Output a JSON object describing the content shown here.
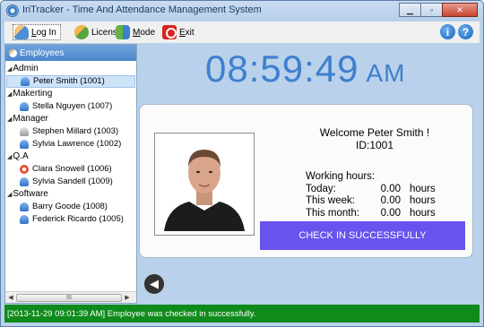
{
  "window": {
    "title": "IriTracker - Time And Attendance Management System",
    "minimize_glyph": "▁",
    "maximize_glyph": "▫",
    "close_glyph": "✕"
  },
  "toolbar": {
    "login_prefix": "L",
    "login_rest": "og In",
    "license_label": "License",
    "mode_prefix": "M",
    "mode_rest": "ode",
    "exit_prefix": "E",
    "exit_rest": "xit",
    "info_glyph": "i",
    "help_glyph": "?"
  },
  "employees_panel": {
    "header": "Employees",
    "groups": [
      {
        "name": "Admin",
        "members": [
          {
            "name": "Peter Smith (1001)",
            "status": "online",
            "selected": true
          }
        ]
      },
      {
        "name": "Makerting",
        "members": [
          {
            "name": "Stella Nguyen (1007)",
            "status": "online"
          }
        ]
      },
      {
        "name": "Manager",
        "members": [
          {
            "name": "Stephen Millard (1003)",
            "status": "offline"
          },
          {
            "name": "Sylvia Lawrence (1002)",
            "status": "online"
          }
        ]
      },
      {
        "name": "Q.A",
        "members": [
          {
            "name": "Clara Snowell (1006)",
            "status": "away"
          },
          {
            "name": "Sylvia Sandell (1009)",
            "status": "online"
          }
        ]
      },
      {
        "name": "Software",
        "members": [
          {
            "name": "Barry Goode (1008)",
            "status": "online"
          },
          {
            "name": "Federick Ricardo (1005)",
            "status": "online"
          }
        ]
      }
    ],
    "scroll_grip": "III"
  },
  "clock": {
    "time": "08:59:49",
    "ampm": "AM"
  },
  "card": {
    "welcome_line": "Welcome Peter Smith !",
    "id_line": "ID:1001",
    "working_hours_label": "Working hours:",
    "rows": [
      {
        "label": "Today:",
        "value": "0.00",
        "unit": "hours"
      },
      {
        "label": "This week:",
        "value": "0.00",
        "unit": "hours"
      },
      {
        "label": "This month:",
        "value": "0.00",
        "unit": "hours"
      }
    ],
    "checkin_label": "CHECK IN SUCCESSFULLY",
    "accent_color": "#6753ee"
  },
  "back_glyph": "◀",
  "status": {
    "text": "[2013-11-29 09:01:39 AM]  Employee was checked in successfully.",
    "color": "#0f8b1b"
  }
}
